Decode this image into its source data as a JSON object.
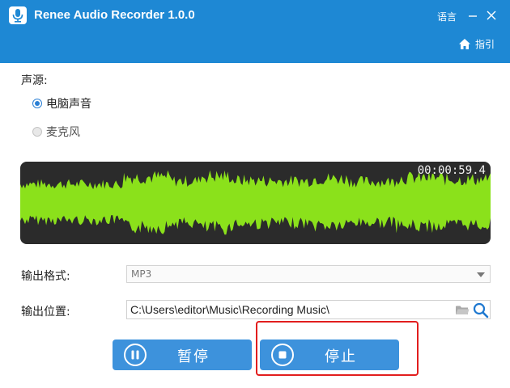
{
  "window": {
    "title": "Renee Audio Recorder 1.0.0",
    "language_label": "语言",
    "guide_label": "指引"
  },
  "source": {
    "label": "声源:",
    "options": [
      {
        "label": "电脑声音",
        "selected": true
      },
      {
        "label": "麦克风",
        "selected": false
      }
    ]
  },
  "waveform": {
    "elapsed_time": "00:00:59.4",
    "color": "#8be11b"
  },
  "output": {
    "format_label": "输出格式:",
    "format_value": "MP3",
    "location_label": "输出位置:",
    "location_value": "C:\\Users\\editor\\Music\\Recording Music\\"
  },
  "controls": {
    "pause_label": "暂停",
    "stop_label": "停止"
  },
  "colors": {
    "titlebar": "#1e88d4",
    "button": "#3d92dc",
    "highlight": "#e21e1e"
  }
}
